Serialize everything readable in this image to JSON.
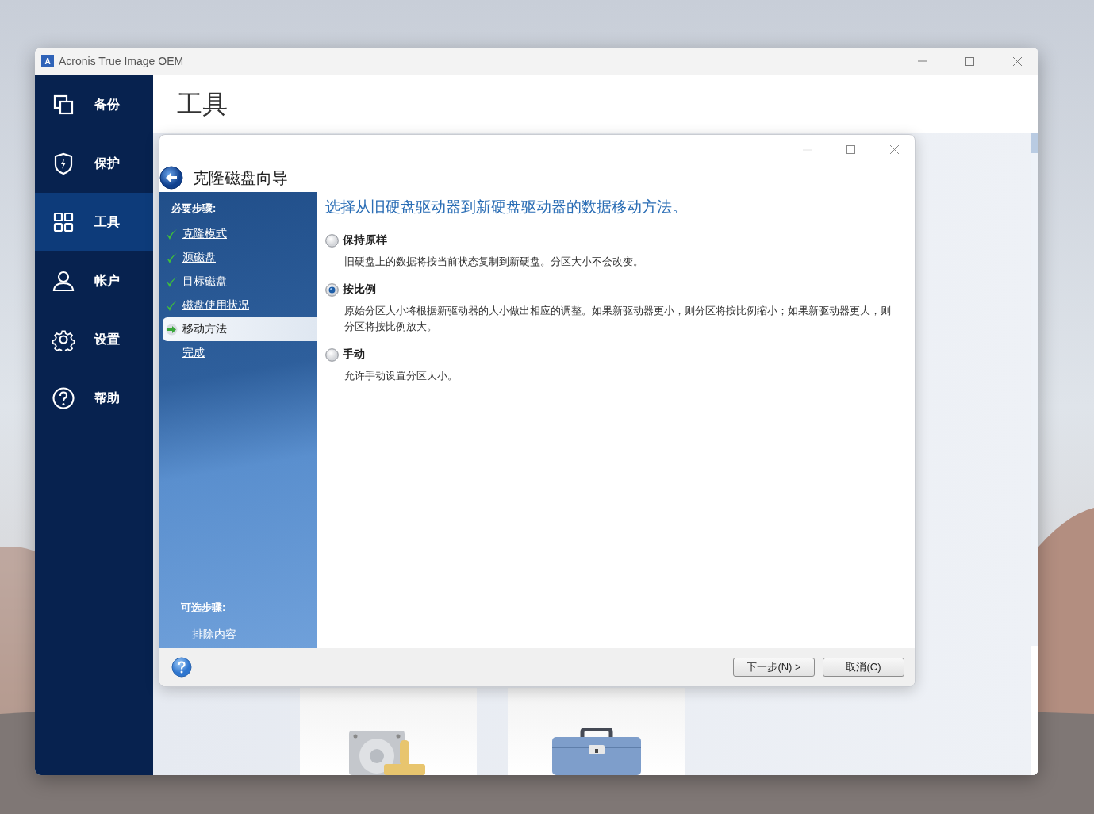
{
  "window": {
    "icon_letter": "A",
    "title": "Acronis True Image OEM"
  },
  "sidebar": {
    "items": [
      {
        "label": "备份",
        "selected": false
      },
      {
        "label": "保护",
        "selected": false
      },
      {
        "label": "工具",
        "selected": true
      },
      {
        "label": "帐户",
        "selected": false
      },
      {
        "label": "设置",
        "selected": false
      },
      {
        "label": "帮助",
        "selected": false
      }
    ]
  },
  "page": {
    "title": "工具"
  },
  "wizard": {
    "title": "克隆磁盘向导",
    "required_heading": "必要步骤:",
    "steps": [
      {
        "label": "克隆模式",
        "done": true,
        "selected": false
      },
      {
        "label": "源磁盘",
        "done": true,
        "selected": false
      },
      {
        "label": "目标磁盘",
        "done": true,
        "selected": false
      },
      {
        "label": "磁盘使用状况",
        "done": true,
        "selected": false
      },
      {
        "label": "移动方法",
        "done": false,
        "selected": true
      },
      {
        "label": "完成",
        "done": false,
        "selected": false
      }
    ],
    "optional_heading": "可选步骤:",
    "optional_steps": [
      {
        "label": "排除内容",
        "selected": false
      }
    ],
    "prompt": "选择从旧硬盘驱动器到新硬盘驱动器的数据移动方法。",
    "options": [
      {
        "label": "保持原样",
        "description": "旧硬盘上的数据将按当前状态复制到新硬盘。分区大小不会改变。",
        "selected": false
      },
      {
        "label": "按比例",
        "description": "原始分区大小将根据新驱动器的大小做出相应的调整。如果新驱动器更小，则分区将按比例缩小；如果新驱动器更大，则分区将按比例放大。",
        "selected": true
      },
      {
        "label": "手动",
        "description": "允许手动设置分区大小。",
        "selected": false
      }
    ],
    "buttons": [
      {
        "label": "下一步(N) >"
      },
      {
        "label": "取消(C)"
      }
    ]
  }
}
